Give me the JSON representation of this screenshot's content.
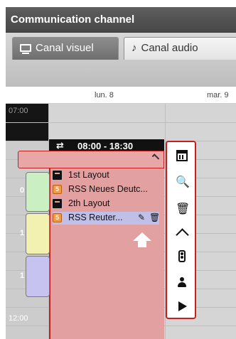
{
  "window": {
    "title": "Communication channel"
  },
  "tabs": [
    {
      "label": "Canal visuel",
      "icon": "monitor-icon",
      "active": true
    },
    {
      "label": "Canal audio",
      "icon": "music-note-icon",
      "active": false
    }
  ],
  "calendar": {
    "days": [
      "lun. 8",
      "mar. 9"
    ],
    "time_labels": {
      "early": "07:00",
      "noon": "12:00"
    },
    "side_labels": [
      "0",
      "1",
      "1"
    ]
  },
  "event": {
    "time_range": "08:00 - 18:30",
    "swap_icon": "swap-arrows-icon",
    "layouts": [
      {
        "label": "1st Layout",
        "icon": "layout-icon"
      },
      {
        "label": "RSS Neues Deutc...",
        "icon": "rss-icon",
        "badge": "5"
      },
      {
        "label": "2th Layout",
        "icon": "layout-icon"
      },
      {
        "label": "RSS Reuter...",
        "icon": "rss-icon",
        "badge": "5",
        "selected": true
      }
    ]
  },
  "toolbar": {
    "items": [
      "calendar-icon",
      "zoom-in-icon",
      "trash-icon",
      "collapse-icon",
      "traffic-light-icon",
      "user-icon",
      "play-icon"
    ]
  },
  "colors": {
    "event_fill": "#e2a0a0",
    "event_border": "#c42020",
    "green_block": "#c9efc3",
    "yellow_block": "#f2f1b2",
    "purple_block": "#c6c3f0"
  }
}
